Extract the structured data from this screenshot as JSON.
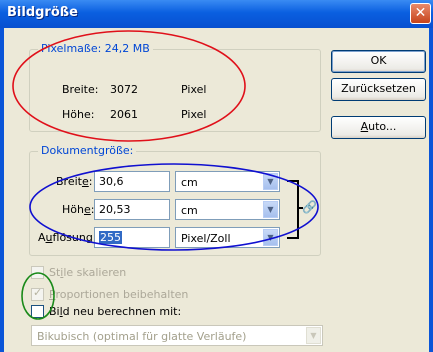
{
  "window": {
    "title": "Bildgröße"
  },
  "pixel_dimensions": {
    "title": "Pixelmaße: 24,2 MB",
    "width_label": "Breite:",
    "width_value": "3072",
    "width_unit": "Pixel",
    "height_label": "Höhe:",
    "height_value": "2061",
    "height_unit": "Pixel"
  },
  "buttons": {
    "ok": "OK",
    "reset": "Zurücksetzen",
    "auto_pre": "",
    "auto_u": "A",
    "auto_post": "uto..."
  },
  "document_size": {
    "title": "Dokumentgröße:",
    "width_label_pre": "Breit",
    "width_label_u": "e",
    "width_label_post": ":",
    "width_value": "30,6",
    "width_unit": "cm",
    "height_label_pre": "Höh",
    "height_label_u": "e",
    "height_label_post": ":",
    "height_value": "20,53",
    "height_unit": "cm",
    "resolution_label_pre": "A",
    "resolution_label_u": "u",
    "resolution_label_post": "flösung:",
    "resolution_value": "255",
    "resolution_unit": "Pixel/Zoll"
  },
  "options": {
    "scale_styles_pre": "St",
    "scale_styles_u": "i",
    "scale_styles_post": "le skalieren",
    "constrain_pre": "",
    "constrain_u": "P",
    "constrain_post": "roportionen beibehalten",
    "resample_pre": "Bi",
    "resample_u": "l",
    "resample_post": "d neu berechnen mit:",
    "resample_method": "Bikubisch (optimal für glatte Verläufe)"
  },
  "annotation_colors": {
    "red": "#e0101a",
    "blue": "#1010d0",
    "green": "#1a8a1a"
  }
}
